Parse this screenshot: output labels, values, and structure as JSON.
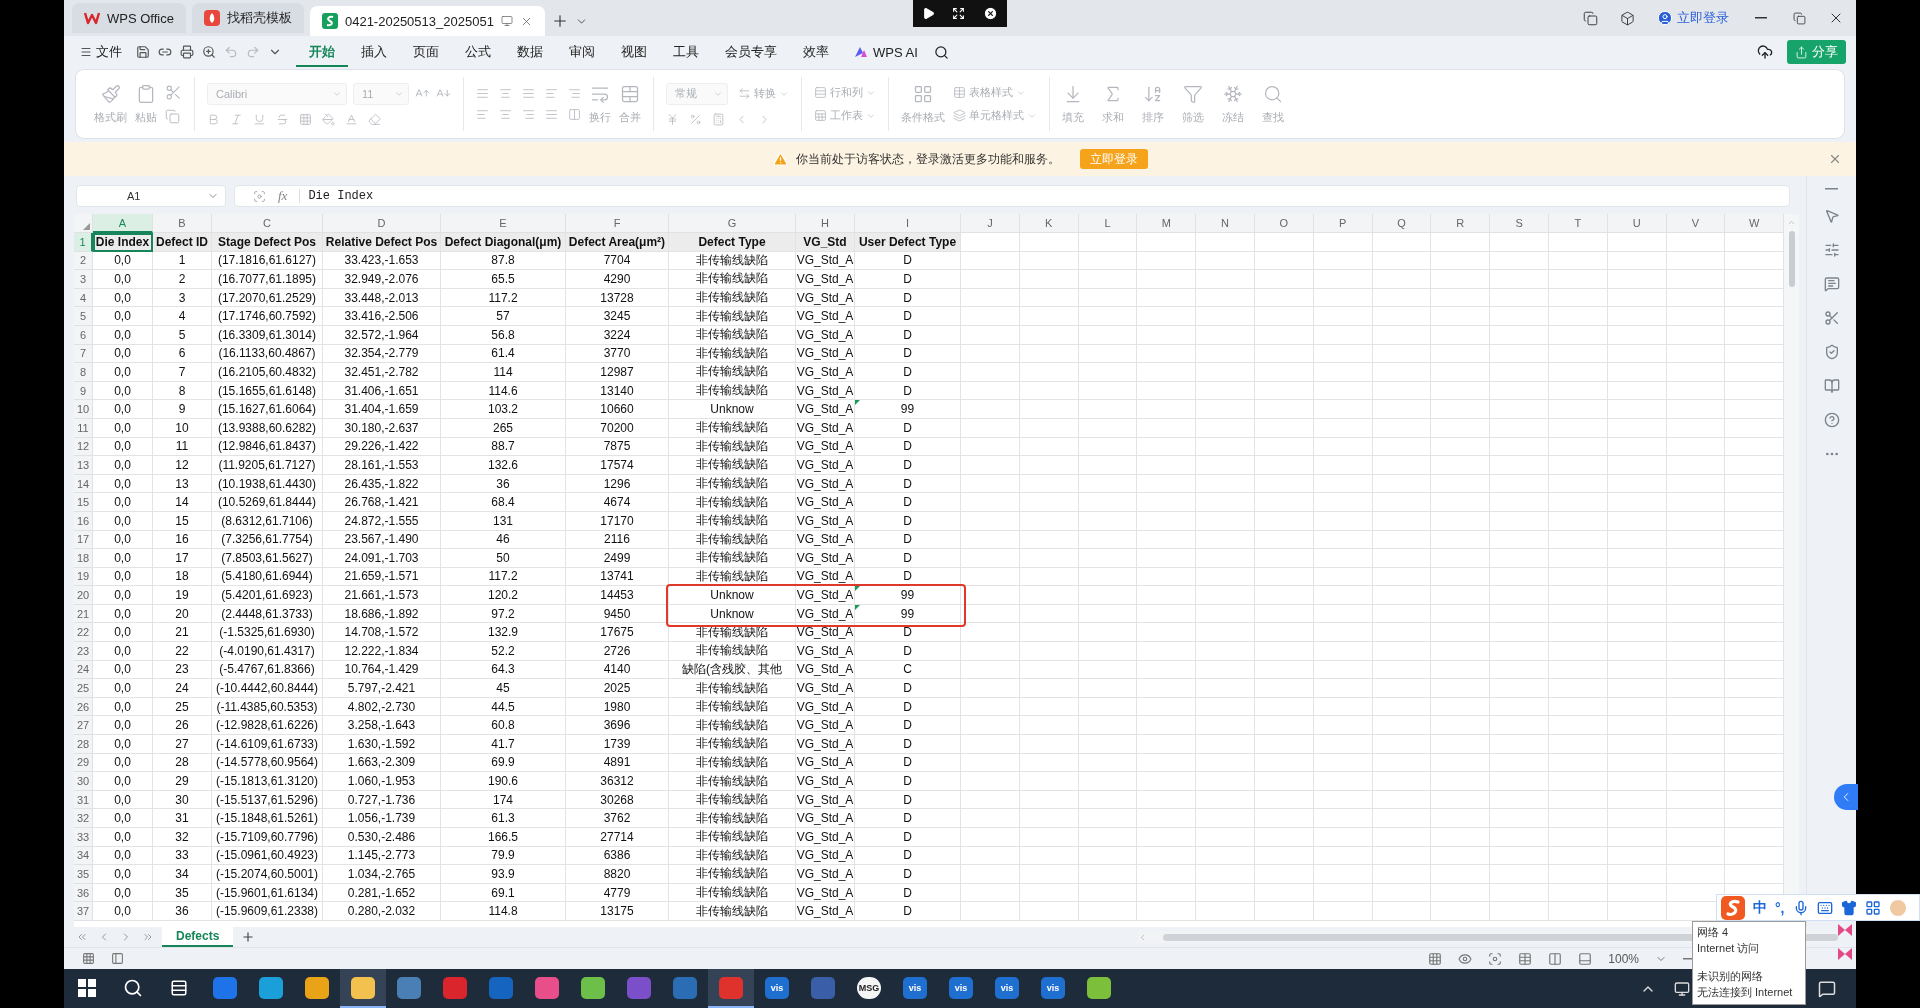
{
  "title_bar": {
    "tabs": [
      {
        "label": "WPS Office",
        "kind": "home",
        "selected": false
      },
      {
        "label": "找稻壳模板",
        "kind": "template",
        "selected": false
      },
      {
        "label": "0421-20250513_2025051",
        "kind": "sheet",
        "selected": true
      }
    ],
    "login": "立即登录"
  },
  "menu": {
    "file": "文件",
    "tabs": [
      {
        "label": "开始",
        "selected": true
      },
      {
        "label": "插入",
        "selected": false
      },
      {
        "label": "页面",
        "selected": false
      },
      {
        "label": "公式",
        "selected": false
      },
      {
        "label": "数据",
        "selected": false
      },
      {
        "label": "审阅",
        "selected": false
      },
      {
        "label": "视图",
        "selected": false
      },
      {
        "label": "工具",
        "selected": false
      },
      {
        "label": "会员专享",
        "selected": false
      },
      {
        "label": "效率",
        "selected": false
      }
    ],
    "ai": "WPS AI",
    "share": "分享"
  },
  "ribbon": {
    "disabled": true,
    "clipboard": [
      {
        "label": "格式刷"
      },
      {
        "label": "粘贴"
      }
    ],
    "font_name": "Calibri",
    "font_size": "11",
    "wrap": "换行",
    "merge": "合并",
    "number_format": "常规",
    "convert": "转换",
    "rows_cols": "行和列",
    "sheet": "工作表",
    "cond_format": "条件格式",
    "table_style": "表格样式",
    "cell_style": "单元格样式",
    "tools": [
      {
        "label": "填充"
      },
      {
        "label": "求和"
      },
      {
        "label": "排序"
      },
      {
        "label": "筛选"
      },
      {
        "label": "冻结"
      },
      {
        "label": "查找"
      }
    ]
  },
  "notice": {
    "text": "你当前处于访客状态，登录激活更多功能和服务。",
    "button": "立即登录"
  },
  "sheet": {
    "name_box": "A1",
    "fx": "fx",
    "formula": "Die Index",
    "columns": [
      {
        "letter": "A",
        "selected": true
      },
      {
        "letter": "B",
        "selected": false
      },
      {
        "letter": "C",
        "selected": false
      },
      {
        "letter": "D",
        "selected": false
      },
      {
        "letter": "E",
        "selected": false
      },
      {
        "letter": "F",
        "selected": false
      },
      {
        "letter": "G",
        "selected": false
      },
      {
        "letter": "H",
        "selected": false
      },
      {
        "letter": "I",
        "selected": false
      },
      {
        "letter": "J",
        "selected": false
      },
      {
        "letter": "K",
        "selected": false
      },
      {
        "letter": "L",
        "selected": false
      },
      {
        "letter": "M",
        "selected": false
      },
      {
        "letter": "N",
        "selected": false
      },
      {
        "letter": "O",
        "selected": false
      },
      {
        "letter": "P",
        "selected": false
      },
      {
        "letter": "Q",
        "selected": false
      },
      {
        "letter": "R",
        "selected": false
      },
      {
        "letter": "S",
        "selected": false
      },
      {
        "letter": "T",
        "selected": false
      },
      {
        "letter": "U",
        "selected": false
      },
      {
        "letter": "V",
        "selected": false
      },
      {
        "letter": "W",
        "selected": false
      }
    ],
    "rows": [
      {
        "number": "1",
        "kind": "header",
        "selected": true,
        "marked": false,
        "outlined": false,
        "cells": [
          "Die Index",
          "Defect ID",
          "Stage Defect Pos",
          "Relative Defect Pos",
          "Defect Diagonal(μm)",
          "Defect Area(μm²)",
          "Defect Type",
          "VG_Std",
          "User Defect Type"
        ]
      },
      {
        "number": "2",
        "kind": "data",
        "selected": false,
        "marked": false,
        "outlined": false,
        "cells": [
          "0,0",
          "1",
          "(17.1816,61.6127)",
          "33.423,-1.653",
          "87.8",
          "7704",
          "非传输线缺陷",
          "VG_Std_A",
          "D"
        ]
      },
      {
        "number": "3",
        "kind": "data",
        "selected": false,
        "marked": false,
        "outlined": false,
        "cells": [
          "0,0",
          "2",
          "(16.7077,61.1895)",
          "32.949,-2.076",
          "65.5",
          "4290",
          "非传输线缺陷",
          "VG_Std_A",
          "D"
        ]
      },
      {
        "number": "4",
        "kind": "data",
        "selected": false,
        "marked": false,
        "outlined": false,
        "cells": [
          "0,0",
          "3",
          "(17.2070,61.2529)",
          "33.448,-2.013",
          "117.2",
          "13728",
          "非传输线缺陷",
          "VG_Std_A",
          "D"
        ]
      },
      {
        "number": "5",
        "kind": "data",
        "selected": false,
        "marked": false,
        "outlined": false,
        "cells": [
          "0,0",
          "4",
          "(17.1746,60.7592)",
          "33.416,-2.506",
          "57",
          "3245",
          "非传输线缺陷",
          "VG_Std_A",
          "D"
        ]
      },
      {
        "number": "6",
        "kind": "data",
        "selected": false,
        "marked": false,
        "outlined": false,
        "cells": [
          "0,0",
          "5",
          "(16.3309,61.3014)",
          "32.572,-1.964",
          "56.8",
          "3224",
          "非传输线缺陷",
          "VG_Std_A",
          "D"
        ]
      },
      {
        "number": "7",
        "kind": "data",
        "selected": false,
        "marked": false,
        "outlined": false,
        "cells": [
          "0,0",
          "6",
          "(16.1133,60.4867)",
          "32.354,-2.779",
          "61.4",
          "3770",
          "非传输线缺陷",
          "VG_Std_A",
          "D"
        ]
      },
      {
        "number": "8",
        "kind": "data",
        "selected": false,
        "marked": false,
        "outlined": false,
        "cells": [
          "0,0",
          "7",
          "(16.2105,60.4832)",
          "32.451,-2.782",
          "114",
          "12987",
          "非传输线缺陷",
          "VG_Std_A",
          "D"
        ]
      },
      {
        "number": "9",
        "kind": "data",
        "selected": false,
        "marked": false,
        "outlined": false,
        "cells": [
          "0,0",
          "8",
          "(15.1655,61.6148)",
          "31.406,-1.651",
          "114.6",
          "13140",
          "非传输线缺陷",
          "VG_Std_A",
          "D"
        ]
      },
      {
        "number": "10",
        "kind": "data",
        "selected": false,
        "marked": true,
        "outlined": false,
        "cells": [
          "0,0",
          "9",
          "(15.1627,61.6064)",
          "31.404,-1.659",
          "103.2",
          "10660",
          "Unknow",
          "VG_Std_A",
          "99"
        ]
      },
      {
        "number": "11",
        "kind": "data",
        "selected": false,
        "marked": false,
        "outlined": false,
        "cells": [
          "0,0",
          "10",
          "(13.9388,60.6282)",
          "30.180,-2.637",
          "265",
          "70200",
          "非传输线缺陷",
          "VG_Std_A",
          "D"
        ]
      },
      {
        "number": "12",
        "kind": "data",
        "selected": false,
        "marked": false,
        "outlined": false,
        "cells": [
          "0,0",
          "11",
          "(12.9846,61.8437)",
          "29.226,-1.422",
          "88.7",
          "7875",
          "非传输线缺陷",
          "VG_Std_A",
          "D"
        ]
      },
      {
        "number": "13",
        "kind": "data",
        "selected": false,
        "marked": false,
        "outlined": false,
        "cells": [
          "0,0",
          "12",
          "(11.9205,61.7127)",
          "28.161,-1.553",
          "132.6",
          "17574",
          "非传输线缺陷",
          "VG_Std_A",
          "D"
        ]
      },
      {
        "number": "14",
        "kind": "data",
        "selected": false,
        "marked": false,
        "outlined": false,
        "cells": [
          "0,0",
          "13",
          "(10.1938,61.4430)",
          "26.435,-1.822",
          "36",
          "1296",
          "非传输线缺陷",
          "VG_Std_A",
          "D"
        ]
      },
      {
        "number": "15",
        "kind": "data",
        "selected": false,
        "marked": false,
        "outlined": false,
        "cells": [
          "0,0",
          "14",
          "(10.5269,61.8444)",
          "26.768,-1.421",
          "68.4",
          "4674",
          "非传输线缺陷",
          "VG_Std_A",
          "D"
        ]
      },
      {
        "number": "16",
        "kind": "data",
        "selected": false,
        "marked": false,
        "outlined": false,
        "cells": [
          "0,0",
          "15",
          "(8.6312,61.7106)",
          "24.872,-1.555",
          "131",
          "17170",
          "非传输线缺陷",
          "VG_Std_A",
          "D"
        ]
      },
      {
        "number": "17",
        "kind": "data",
        "selected": false,
        "marked": false,
        "outlined": false,
        "cells": [
          "0,0",
          "16",
          "(7.3256,61.7754)",
          "23.567,-1.490",
          "46",
          "2116",
          "非传输线缺陷",
          "VG_Std_A",
          "D"
        ]
      },
      {
        "number": "18",
        "kind": "data",
        "selected": false,
        "marked": false,
        "outlined": false,
        "cells": [
          "0,0",
          "17",
          "(7.8503,61.5627)",
          "24.091,-1.703",
          "50",
          "2499",
          "非传输线缺陷",
          "VG_Std_A",
          "D"
        ]
      },
      {
        "number": "19",
        "kind": "data",
        "selected": false,
        "marked": false,
        "outlined": false,
        "cells": [
          "0,0",
          "18",
          "(5.4180,61.6944)",
          "21.659,-1.571",
          "117.2",
          "13741",
          "非传输线缺陷",
          "VG_Std_A",
          "D"
        ]
      },
      {
        "number": "20",
        "kind": "data",
        "selected": false,
        "marked": true,
        "outlined": true,
        "cells": [
          "0,0",
          "19",
          "(5.4201,61.6923)",
          "21.661,-1.573",
          "120.2",
          "14453",
          "Unknow",
          "VG_Std_A",
          "99"
        ]
      },
      {
        "number": "21",
        "kind": "data",
        "selected": false,
        "marked": true,
        "outlined": true,
        "cells": [
          "0,0",
          "20",
          "(2.4448,61.3733)",
          "18.686,-1.892",
          "97.2",
          "9450",
          "Unknow",
          "VG_Std_A",
          "99"
        ]
      },
      {
        "number": "22",
        "kind": "data",
        "selected": false,
        "marked": false,
        "outlined": false,
        "cells": [
          "0,0",
          "21",
          "(-1.5325,61.6930)",
          "14.708,-1.572",
          "132.9",
          "17675",
          "非传输线缺陷",
          "VG_Std_A",
          "D"
        ]
      },
      {
        "number": "23",
        "kind": "data",
        "selected": false,
        "marked": false,
        "outlined": false,
        "cells": [
          "0,0",
          "22",
          "(-4.0190,61.4317)",
          "12.222,-1.834",
          "52.2",
          "2726",
          "非传输线缺陷",
          "VG_Std_A",
          "D"
        ]
      },
      {
        "number": "24",
        "kind": "data",
        "selected": false,
        "marked": false,
        "outlined": false,
        "cells": [
          "0,0",
          "23",
          "(-5.4767,61.8366)",
          "10.764,-1.429",
          "64.3",
          "4140",
          "缺陷(含残胶、其他",
          "VG_Std_A",
          "C"
        ]
      },
      {
        "number": "25",
        "kind": "data",
        "selected": false,
        "marked": false,
        "outlined": false,
        "cells": [
          "0,0",
          "24",
          "(-10.4442,60.8444)",
          "5.797,-2.421",
          "45",
          "2025",
          "非传输线缺陷",
          "VG_Std_A",
          "D"
        ]
      },
      {
        "number": "26",
        "kind": "data",
        "selected": false,
        "marked": false,
        "outlined": false,
        "cells": [
          "0,0",
          "25",
          "(-11.4385,60.5353)",
          "4.802,-2.730",
          "44.5",
          "1980",
          "非传输线缺陷",
          "VG_Std_A",
          "D"
        ]
      },
      {
        "number": "27",
        "kind": "data",
        "selected": false,
        "marked": false,
        "outlined": false,
        "cells": [
          "0,0",
          "26",
          "(-12.9828,61.6226)",
          "3.258,-1.643",
          "60.8",
          "3696",
          "非传输线缺陷",
          "VG_Std_A",
          "D"
        ]
      },
      {
        "number": "28",
        "kind": "data",
        "selected": false,
        "marked": false,
        "outlined": false,
        "cells": [
          "0,0",
          "27",
          "(-14.6109,61.6733)",
          "1.630,-1.592",
          "41.7",
          "1739",
          "非传输线缺陷",
          "VG_Std_A",
          "D"
        ]
      },
      {
        "number": "29",
        "kind": "data",
        "selected": false,
        "marked": false,
        "outlined": false,
        "cells": [
          "0,0",
          "28",
          "(-14.5778,60.9564)",
          "1.663,-2.309",
          "69.9",
          "4891",
          "非传输线缺陷",
          "VG_Std_A",
          "D"
        ]
      },
      {
        "number": "30",
        "kind": "data",
        "selected": false,
        "marked": false,
        "outlined": false,
        "cells": [
          "0,0",
          "29",
          "(-15.1813,61.3120)",
          "1.060,-1.953",
          "190.6",
          "36312",
          "非传输线缺陷",
          "VG_Std_A",
          "D"
        ]
      },
      {
        "number": "31",
        "kind": "data",
        "selected": false,
        "marked": false,
        "outlined": false,
        "cells": [
          "0,0",
          "30",
          "(-15.5137,61.5296)",
          "0.727,-1.736",
          "174",
          "30268",
          "非传输线缺陷",
          "VG_Std_A",
          "D"
        ]
      },
      {
        "number": "32",
        "kind": "data",
        "selected": false,
        "marked": false,
        "outlined": false,
        "cells": [
          "0,0",
          "31",
          "(-15.1848,61.5261)",
          "1.056,-1.739",
          "61.3",
          "3762",
          "非传输线缺陷",
          "VG_Std_A",
          "D"
        ]
      },
      {
        "number": "33",
        "kind": "data",
        "selected": false,
        "marked": false,
        "outlined": false,
        "cells": [
          "0,0",
          "32",
          "(-15.7109,60.7796)",
          "0.530,-2.486",
          "166.5",
          "27714",
          "非传输线缺陷",
          "VG_Std_A",
          "D"
        ]
      },
      {
        "number": "34",
        "kind": "data",
        "selected": false,
        "marked": false,
        "outlined": false,
        "cells": [
          "0,0",
          "33",
          "(-15.0961,60.4923)",
          "1.145,-2.773",
          "79.9",
          "6386",
          "非传输线缺陷",
          "VG_Std_A",
          "D"
        ]
      },
      {
        "number": "35",
        "kind": "data",
        "selected": false,
        "marked": false,
        "outlined": false,
        "cells": [
          "0,0",
          "34",
          "(-15.2074,60.5001)",
          "1.034,-2.765",
          "93.9",
          "8820",
          "非传输线缺陷",
          "VG_Std_A",
          "D"
        ]
      },
      {
        "number": "36",
        "kind": "data",
        "selected": false,
        "marked": false,
        "outlined": false,
        "cells": [
          "0,0",
          "35",
          "(-15.9601,61.6134)",
          "0.281,-1.652",
          "69.1",
          "4779",
          "非传输线缺陷",
          "VG_Std_A",
          "D"
        ]
      },
      {
        "number": "37",
        "kind": "data",
        "selected": false,
        "marked": false,
        "outlined": false,
        "cells": [
          "0,0",
          "36",
          "(-15.9609,61.2338)",
          "0.280,-2.032",
          "114.8",
          "13175",
          "非传输线缺陷",
          "VG_Std_A",
          "D"
        ]
      }
    ],
    "sheet_tabs": [
      {
        "label": "Defects",
        "selected": true
      }
    ],
    "zoom": "100%"
  },
  "taskbar": [
    {
      "kind": "start",
      "active": false
    },
    {
      "kind": "search",
      "active": false
    },
    {
      "kind": "taskview",
      "active": false
    },
    {
      "kind": "app",
      "color": "#1e73e8",
      "active": false
    },
    {
      "kind": "app",
      "color": "#1a9fd9",
      "active": false
    },
    {
      "kind": "app",
      "color": "#e8a317",
      "active": false
    },
    {
      "kind": "app",
      "color": "#f2c14e",
      "active": true
    },
    {
      "kind": "app",
      "color": "#4a7fb5",
      "active": false
    },
    {
      "kind": "app",
      "color": "#d9252b",
      "active": false
    },
    {
      "kind": "app",
      "color": "#1565c0",
      "active": false
    },
    {
      "kind": "app",
      "color": "#e84f8a",
      "active": false
    },
    {
      "kind": "app",
      "color": "#6cc04a",
      "active": false
    },
    {
      "kind": "app",
      "color": "#7b4fc9",
      "active": false
    },
    {
      "kind": "app",
      "color": "#2a6db5",
      "active": false
    },
    {
      "kind": "app",
      "color": "#e0322c",
      "active": true
    },
    {
      "kind": "app",
      "color": "#1f6fd0",
      "label": "vis",
      "active": false
    },
    {
      "kind": "app",
      "color": "#3a5fa8",
      "active": false
    },
    {
      "kind": "app",
      "color": "#f5f5f5",
      "label": "MSG",
      "active": false
    },
    {
      "kind": "app",
      "color": "#1f6fd0",
      "label": "vis",
      "active": false
    },
    {
      "kind": "app",
      "color": "#1f6fd0",
      "label": "vis",
      "active": false
    },
    {
      "kind": "app",
      "color": "#1f6fd0",
      "label": "vis",
      "active": false
    },
    {
      "kind": "app",
      "color": "#1f6fd0",
      "label": "vis",
      "active": false
    },
    {
      "kind": "app",
      "color": "#7cbf3a",
      "active": false
    }
  ],
  "network_tooltip": {
    "status": [
      "网络 4",
      "Internet 访问"
    ],
    "detail": [
      "未识别的网络",
      "无法连接到 Internet"
    ]
  },
  "ime_bar": {
    "mode": "中",
    "punct": "°,"
  }
}
